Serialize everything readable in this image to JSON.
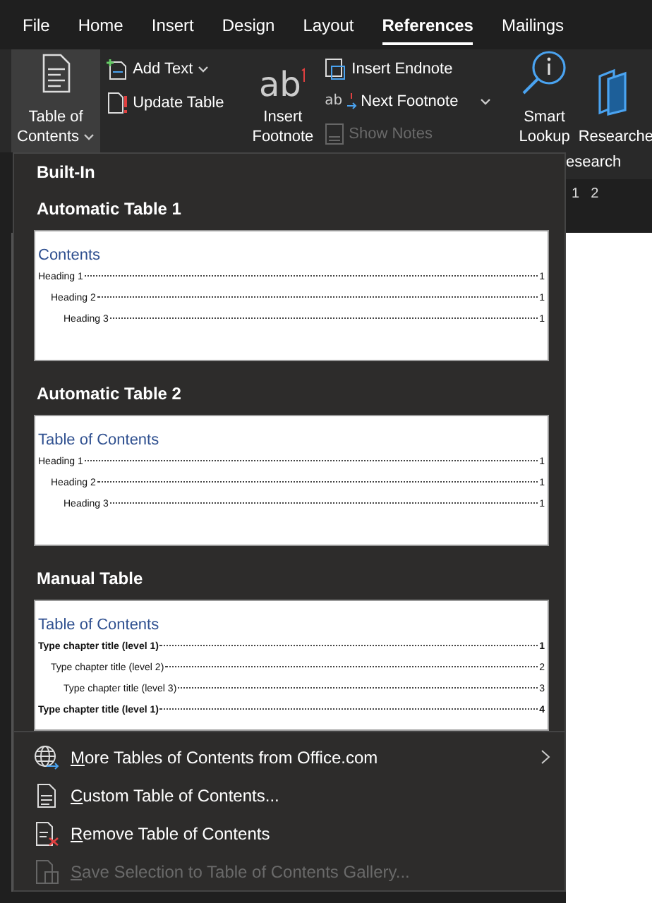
{
  "tabs": [
    {
      "label": "File",
      "selected": false
    },
    {
      "label": "Home",
      "selected": false
    },
    {
      "label": "Insert",
      "selected": false
    },
    {
      "label": "Design",
      "selected": false
    },
    {
      "label": "Layout",
      "selected": false
    },
    {
      "label": "References",
      "selected": true
    },
    {
      "label": "Mailings",
      "selected": false
    }
  ],
  "ribbon": {
    "toc_button": {
      "lines": [
        "Table of",
        "Contents"
      ],
      "open": true
    },
    "toc_small": [
      {
        "label": "Add Text",
        "kind": "add-text",
        "has_menu": true,
        "disabled": false
      },
      {
        "label": "Update Table",
        "kind": "update",
        "has_menu": false,
        "disabled": false
      }
    ],
    "footnote_button": {
      "icon_text": "ab",
      "lines": [
        "Insert",
        "Footnote"
      ]
    },
    "footnote_small": [
      {
        "label": "Insert Endnote",
        "kind": "endnote",
        "has_menu": false,
        "disabled": false
      },
      {
        "label": "Next Footnote",
        "kind": "next-footnote",
        "icon_text": "ab",
        "has_menu": true,
        "disabled": false
      },
      {
        "label": "Show Notes",
        "kind": "show-notes",
        "has_menu": false,
        "disabled": true
      }
    ],
    "research_buttons": [
      {
        "lines": [
          "Smart",
          "Lookup"
        ],
        "kind": "lookup"
      },
      {
        "lines": [
          "Researche"
        ],
        "kind": "researcher"
      }
    ],
    "group_label": "esearch"
  },
  "ruler": {
    "marks": [
      "1",
      "2"
    ]
  },
  "menu": {
    "header": "Built-In",
    "gallery": [
      {
        "title": "Automatic Table 1",
        "preview": {
          "heading": "Contents",
          "entries": [
            {
              "text": "Heading 1",
              "page": "1",
              "bold": false,
              "children": [
                {
                  "text": "Heading 2",
                  "page": "1",
                  "bold": false,
                  "children": [
                    {
                      "text": "Heading 3",
                      "page": "1",
                      "bold": false
                    }
                  ]
                }
              ]
            }
          ]
        }
      },
      {
        "title": "Automatic Table 2",
        "preview": {
          "heading": "Table of Contents",
          "entries": [
            {
              "text": "Heading 1",
              "page": "1",
              "bold": false,
              "children": [
                {
                  "text": "Heading 2",
                  "page": "1",
                  "bold": false,
                  "children": [
                    {
                      "text": "Heading 3",
                      "page": "1",
                      "bold": false
                    }
                  ]
                }
              ]
            }
          ]
        }
      },
      {
        "title": "Manual Table",
        "preview": {
          "heading": "Table of Contents",
          "entries": [
            {
              "text": "Type chapter title (level 1)",
              "page": "1",
              "bold": true,
              "children": [
                {
                  "text": "Type chapter title (level 2)",
                  "page": "2",
                  "bold": false,
                  "children": [
                    {
                      "text": "Type chapter title (level 3)",
                      "page": "3",
                      "bold": false
                    }
                  ]
                }
              ]
            },
            {
              "text": "Type chapter title (level 1)",
              "page": "4",
              "bold": true
            }
          ]
        }
      }
    ],
    "items": [
      {
        "label": "More Tables of Contents from Office.com",
        "kind": "globe",
        "has_submenu": true,
        "disabled": false
      },
      {
        "label": "Custom Table of Contents...",
        "kind": "custom",
        "has_submenu": false,
        "disabled": false
      },
      {
        "label": "Remove Table of Contents",
        "kind": "remove",
        "has_submenu": false,
        "disabled": false
      },
      {
        "label": "Save Selection to Table of Contents Gallery...",
        "kind": "save",
        "has_submenu": false,
        "disabled": true
      }
    ]
  }
}
